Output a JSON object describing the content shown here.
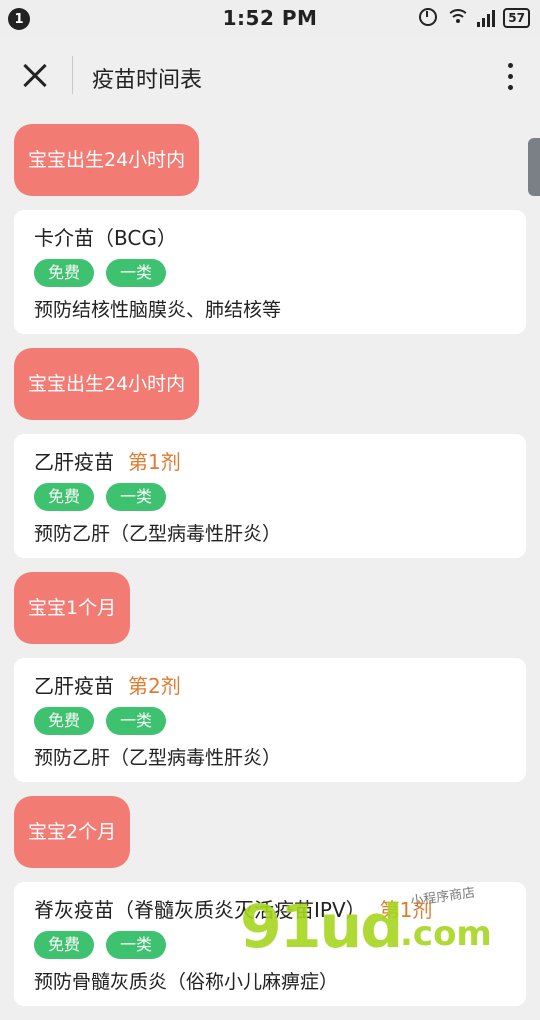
{
  "status_bar": {
    "notification_count": "1",
    "time": "1:52 PM",
    "battery": "57",
    "icons": [
      "alarm-icon",
      "wifi-icon",
      "signal-icon",
      "battery-icon"
    ]
  },
  "header": {
    "title": "疫苗时间表"
  },
  "sections": [
    {
      "tag": "宝宝出生24小时内",
      "vaccine": "卡介苗（BCG）",
      "dose": "",
      "badges": [
        "免费",
        "一类"
      ],
      "desc": "预防结核性脑膜炎、肺结核等"
    },
    {
      "tag": "宝宝出生24小时内",
      "vaccine": "乙肝疫苗",
      "dose": "第1剂",
      "badges": [
        "免费",
        "一类"
      ],
      "desc": "预防乙肝（乙型病毒性肝炎）"
    },
    {
      "tag": "宝宝1个月",
      "vaccine": "乙肝疫苗",
      "dose": "第2剂",
      "badges": [
        "免费",
        "一类"
      ],
      "desc": "预防乙肝（乙型病毒性肝炎）"
    },
    {
      "tag": "宝宝2个月",
      "vaccine": "脊灰疫苗（脊髓灰质炎灭活疫苗IPV）",
      "dose": "第1剂",
      "badges": [
        "免费",
        "一类"
      ],
      "desc": "预防骨髓灰质炎（俗称小儿麻痹症）"
    }
  ],
  "watermark": {
    "brand": "91ud",
    "tld": ".com",
    "tagline": "小程序商店"
  },
  "colors": {
    "tag_bg": "#f27b74",
    "badge_bg": "#3ec26f",
    "dose": "#e07a2f"
  }
}
